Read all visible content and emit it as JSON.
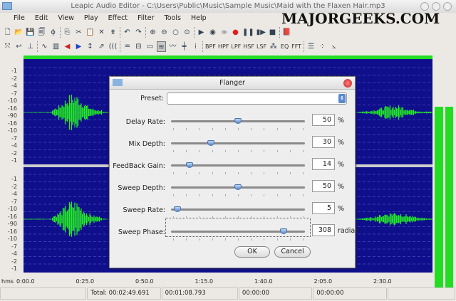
{
  "window": {
    "title": "Leapic Audio Editor - C:\\Users\\Public\\Music\\Sample Music\\Maid with the Flaxen Hair.mp3"
  },
  "watermark": "MAJORGEEKS.COM",
  "menu": [
    "File",
    "Edit",
    "View",
    "Play",
    "Effect",
    "Filter",
    "Tools",
    "Help"
  ],
  "toolbar1": [
    {
      "icon": "new-icon",
      "g": "🗋"
    },
    {
      "icon": "open-icon",
      "g": "📂"
    },
    {
      "icon": "save-icon",
      "g": "💾"
    },
    {
      "icon": "properties-icon",
      "g": "🗐"
    },
    {
      "icon": "brush-icon",
      "g": "ɸ"
    },
    {
      "sep": true
    },
    {
      "icon": "copy-icon",
      "g": "⎘"
    },
    {
      "icon": "cut-icon",
      "g": "✂"
    },
    {
      "icon": "paste-icon",
      "g": "📋"
    },
    {
      "icon": "delete-icon",
      "g": "✕"
    },
    {
      "icon": "trim-icon",
      "g": "⩩"
    },
    {
      "sep": true
    },
    {
      "icon": "undo-icon",
      "g": "↶"
    },
    {
      "icon": "redo-icon",
      "g": "↷"
    },
    {
      "sep": true
    },
    {
      "icon": "zoom-in-icon",
      "g": "⊕"
    },
    {
      "icon": "zoom-out-icon",
      "g": "⊖"
    },
    {
      "icon": "zoom-selection-icon",
      "g": "○"
    },
    {
      "icon": "zoom-all-icon",
      "g": "⊙"
    },
    {
      "sep": true
    },
    {
      "icon": "play-icon",
      "g": "▶"
    },
    {
      "icon": "play-selection-icon",
      "g": "◉"
    },
    {
      "icon": "loop-icon",
      "g": "∞"
    },
    {
      "icon": "record-icon",
      "g": "●",
      "c": "#e02020"
    },
    {
      "icon": "pause-icon",
      "g": "❚❚"
    },
    {
      "icon": "step-icon",
      "g": "▮▶"
    },
    {
      "icon": "stop-icon",
      "g": "■"
    },
    {
      "sep": true
    },
    {
      "icon": "help-book-icon",
      "g": "📕"
    }
  ],
  "toolbar2": [
    {
      "icon": "select-all-icon",
      "g": "⤧"
    },
    {
      "icon": "back-icon",
      "g": "↩"
    },
    {
      "icon": "marker-icon",
      "g": "⊥"
    },
    {
      "sep": true
    },
    {
      "icon": "waveform-icon",
      "g": "∿"
    },
    {
      "icon": "normalize-icon",
      "g": "▥"
    },
    {
      "icon": "fade-in-icon",
      "g": "◀",
      "c": "#d02020"
    },
    {
      "icon": "fade-out-icon",
      "g": "▶",
      "c": "#2040d0"
    },
    {
      "icon": "amplify-icon",
      "g": "↕"
    },
    {
      "icon": "stretch-icon",
      "g": "⇗"
    },
    {
      "icon": "echo-icon",
      "g": "((("
    },
    {
      "sep": true
    },
    {
      "icon": "reverb-icon",
      "g": "♒"
    },
    {
      "icon": "invert-icon",
      "g": "⊟"
    },
    {
      "icon": "silence-icon",
      "g": "▭"
    },
    {
      "icon": "flanger-icon",
      "g": "≋",
      "active": true
    },
    {
      "icon": "chorus-icon",
      "g": "〰"
    },
    {
      "icon": "pitch-icon",
      "g": "╪"
    },
    {
      "icon": "tempo-icon",
      "g": "⁞"
    },
    {
      "sep": true
    },
    {
      "t": "BPF"
    },
    {
      "t": "HPF"
    },
    {
      "t": "LPF"
    },
    {
      "t": "HSF"
    },
    {
      "t": "LSF"
    },
    {
      "icon": "filter-icon",
      "g": "⁂"
    },
    {
      "t": "EQ"
    },
    {
      "t": "FFT"
    },
    {
      "sep": true
    },
    {
      "icon": "settings-icon",
      "g": "☰"
    },
    {
      "icon": "plugin-icon",
      "g": "⁘"
    },
    {
      "icon": "chart-icon",
      "g": "⦣"
    }
  ],
  "axis_labels": [
    "-1",
    "-2",
    "-4",
    "-7",
    "-10",
    "-16",
    "-90",
    "-16",
    "-10",
    "-7",
    "-4",
    "-2",
    "-1"
  ],
  "ruler": {
    "unit": "hms",
    "ticks": [
      "0:00.0",
      "0:25.0",
      "0:50.0",
      "1:15.0",
      "1:40.0",
      "2:05.0",
      "2:30.0"
    ]
  },
  "status": [
    "",
    "Total: 00:02:49.691",
    "00:01:08.793",
    "00:00:00",
    "00:00:00",
    ""
  ],
  "colors": {
    "wave_bg": "#0f0f8c",
    "wave": "#22ee22"
  },
  "dialog": {
    "title": "Flanger",
    "preset_label": "Preset:",
    "preset_value": "",
    "params": [
      {
        "label": "Delay Rate:",
        "value": "50",
        "unit": "%",
        "fraction": 0.5
      },
      {
        "label": "Mix Depth:",
        "value": "30",
        "unit": "%",
        "fraction": 0.3
      },
      {
        "label": "FeedBack Gain:",
        "value": "14",
        "unit": "%",
        "fraction": 0.14
      },
      {
        "label": "Sweep Depth:",
        "value": "50",
        "unit": "%",
        "fraction": 0.5
      },
      {
        "label": "Sweep Rate:",
        "value": "5",
        "unit": "%",
        "fraction": 0.05
      },
      {
        "label": "Sweep Phase:",
        "value": "308",
        "unit": "radian",
        "fraction": 0.84
      }
    ],
    "ok": "OK",
    "cancel": "Cancel"
  }
}
